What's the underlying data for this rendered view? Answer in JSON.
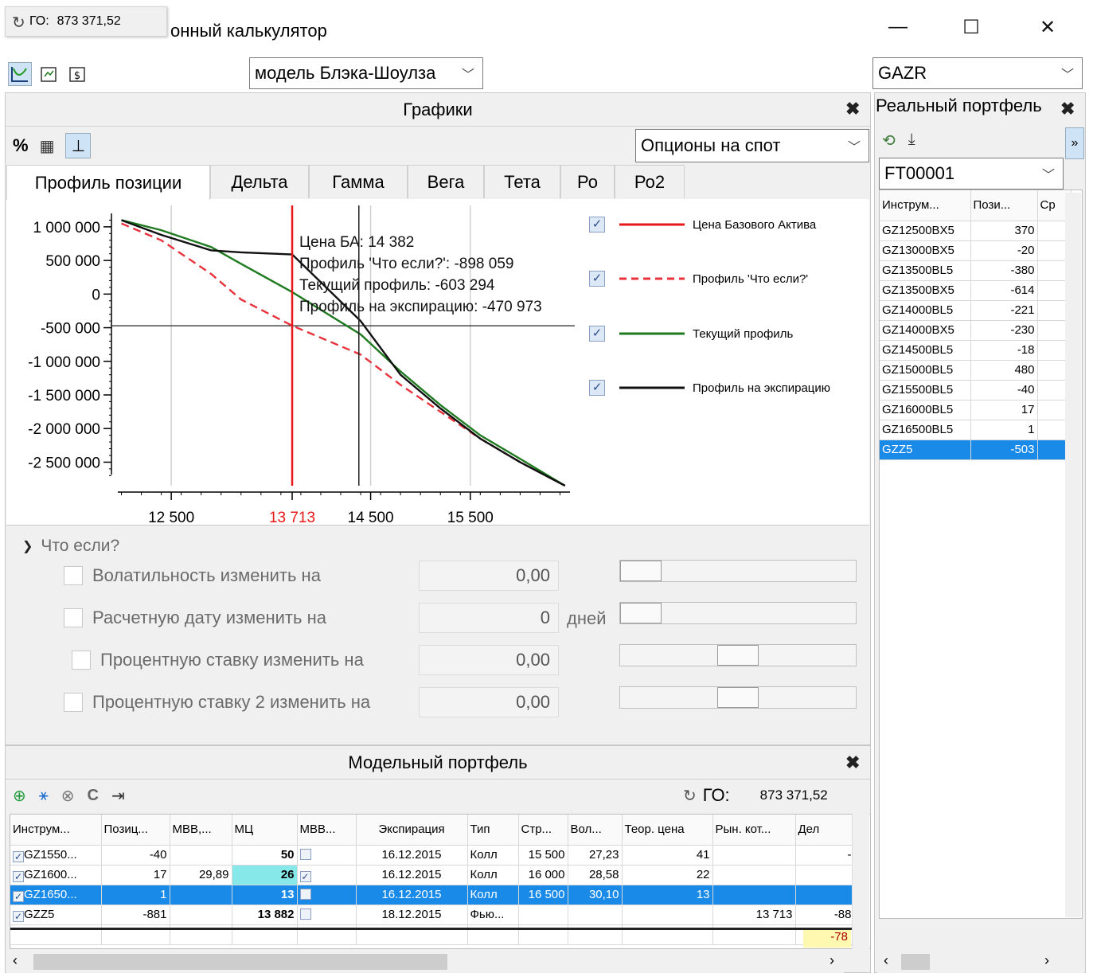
{
  "window": {
    "title": "онный калькулятор",
    "go_label": "ГО:",
    "go_value": "873 371,52",
    "minimize": "—",
    "maximize": "☐",
    "close": "✕"
  },
  "toolbar": {
    "model": "модель Блэка-Шоулза",
    "instrument": "GAZR"
  },
  "charts_panel": {
    "title": "Графики",
    "option_type": "Опционы на спот",
    "percent_btn": "%",
    "tabs": [
      "Профиль позиции",
      "Дельта",
      "Гамма",
      "Вега",
      "Тета",
      "Ро",
      "Ро2"
    ]
  },
  "chart_data": {
    "type": "line",
    "x": [
      12000,
      12400,
      12900,
      13200,
      13713,
      14400,
      14800,
      15200,
      15600,
      16000,
      16450
    ],
    "x_ticks": [
      "12 500",
      "13 713",
      "14 500",
      "15 500"
    ],
    "x_tick_values": [
      12500,
      13713,
      14500,
      15500
    ],
    "y_ticks": [
      "1 000 000",
      "500 000",
      "0",
      "-500 000",
      "-1 000 000",
      "-1 500 000",
      "-2 000 000",
      "-2 500 000"
    ],
    "y_tick_values": [
      1000000,
      500000,
      0,
      -500000,
      -1000000,
      -1500000,
      -2000000,
      -2500000
    ],
    "ylim": [
      -2850000,
      1200000
    ],
    "xlim": [
      11900,
      16500
    ],
    "base_price_x": 13713,
    "cursor_x": 14382,
    "cursor_y": -470973,
    "series": [
      {
        "name": "Профиль 'Что если?'",
        "color": "#e8323c",
        "dashed": true,
        "values": [
          1050000,
          800000,
          300000,
          -80000,
          -470000,
          -900000,
          -1350000,
          -1750000,
          -2150000,
          -2500000,
          -2850000
        ]
      },
      {
        "name": "Текущий профиль",
        "color": "#1e7a1e",
        "dashed": false,
        "values": [
          1100000,
          950000,
          700000,
          450000,
          30000,
          -600000,
          -1150000,
          -1650000,
          -2100000,
          -2450000,
          -2850000
        ]
      },
      {
        "name": "Профиль на экспирацию",
        "color": "#111111",
        "dashed": false,
        "values": [
          1100000,
          880000,
          650000,
          620000,
          590000,
          -400000,
          -1200000,
          -1700000,
          -2150000,
          -2500000,
          -2850000
        ]
      }
    ],
    "base_line_name": "Цена Базового Актива",
    "base_line_color": "#e81818",
    "annotations": {
      "price": "Цена БА: 14 382",
      "what_if": "Профиль 'Что если?': -898 059",
      "current": "Текущий профиль: -603 294",
      "expiry": "Профиль на экспирацию: -470 973"
    },
    "red_tick_label": "13 713",
    "grid": true,
    "legend_position": "right"
  },
  "whatif": {
    "header": "Что если?",
    "rows": [
      {
        "label": "Волатильность изменить на",
        "value": "0,00",
        "unit": ""
      },
      {
        "label": "Расчетную дату изменить на",
        "value": "0",
        "unit": "дней"
      },
      {
        "label": "Процентную ставку изменить на",
        "value": "0,00",
        "unit": ""
      },
      {
        "label": "Процентную ставку 2 изменить на",
        "value": "0,00",
        "unit": ""
      }
    ]
  },
  "model_portfolio": {
    "title": "Модельный портфель",
    "go_label": "ГО:",
    "go_value": "873 371,52",
    "columns": [
      "Инструм...",
      "Позиц...",
      "МВВ,...",
      "МЦ",
      "МВВ...",
      "Экспирация",
      "Тип",
      "Стр...",
      "Вол...",
      "Теор. цена",
      "Рын. кот...",
      "Дел"
    ],
    "rows": [
      {
        "checked": true,
        "instr": "GZ1550...",
        "pos": "-40",
        "mvv": "",
        "mc": "50",
        "mvvchk": false,
        "exp": "16.12.2015",
        "type": "Колл",
        "strike": "15 500",
        "vol": "27,23",
        "theor": "41",
        "mkt": "",
        "delta": "-"
      },
      {
        "checked": true,
        "instr": "GZ1600...",
        "pos": "17",
        "mvv": "29,89",
        "mc": "26",
        "mvvchk": true,
        "exp": "16.12.2015",
        "type": "Колл",
        "strike": "16 000",
        "vol": "28,58",
        "theor": "22",
        "mkt": "",
        "delta": ""
      },
      {
        "checked": true,
        "instr": "GZ1650...",
        "pos": "1",
        "mvv": "",
        "mc": "13",
        "mvvchk": false,
        "exp": "16.12.2015",
        "type": "Колл",
        "strike": "16 500",
        "vol": "30,10",
        "theor": "13",
        "mkt": "",
        "delta": ""
      },
      {
        "checked": true,
        "instr": "GZZ5",
        "pos": "-881",
        "mvv": "",
        "mc": "13 882",
        "mvvchk": false,
        "exp": "18.12.2015",
        "type": "Фью...",
        "strike": "",
        "vol": "",
        "theor": "",
        "mkt": "13 713",
        "delta": "-88"
      }
    ],
    "total_delta": "-78"
  },
  "real_portfolio": {
    "title": "Реальный портфель",
    "account": "FT00001",
    "columns": [
      "Инструм...",
      "Пози...",
      "Ср"
    ],
    "rows": [
      {
        "instr": "GZ12500BX5",
        "pos": "370"
      },
      {
        "instr": "GZ13000BX5",
        "pos": "-20"
      },
      {
        "instr": "GZ13500BL5",
        "pos": "-380"
      },
      {
        "instr": "GZ13500BX5",
        "pos": "-614"
      },
      {
        "instr": "GZ14000BL5",
        "pos": "-221"
      },
      {
        "instr": "GZ14000BX5",
        "pos": "-230"
      },
      {
        "instr": "GZ14500BL5",
        "pos": "-18"
      },
      {
        "instr": "GZ15000BL5",
        "pos": "480"
      },
      {
        "instr": "GZ15500BL5",
        "pos": "-40"
      },
      {
        "instr": "GZ16000BL5",
        "pos": "17"
      },
      {
        "instr": "GZ16500BL5",
        "pos": "1"
      },
      {
        "instr": "GZZ5",
        "pos": "-503"
      }
    ]
  },
  "colors": {
    "selection": "#1a8ae8",
    "accent_cyan": "#86e8e8",
    "total_yellow": "#fff8b0"
  }
}
